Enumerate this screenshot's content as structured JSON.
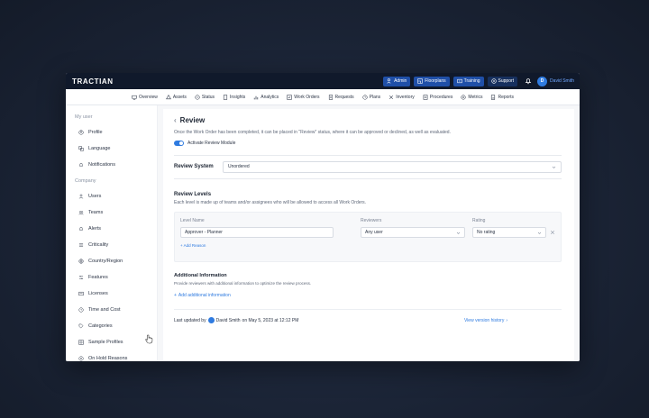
{
  "topbar": {
    "logo": "TRACTIAN",
    "buttons": [
      {
        "label": "Admin",
        "icon": "user-shield-icon"
      },
      {
        "label": "Floorplans",
        "icon": "floorplan-icon"
      },
      {
        "label": "Training",
        "icon": "training-icon"
      },
      {
        "label": "Support",
        "icon": "support-icon"
      }
    ],
    "user": {
      "initial": "D",
      "name": "David Smith"
    }
  },
  "nav": [
    {
      "label": "Overview",
      "icon": "monitor-icon"
    },
    {
      "label": "Assets",
      "icon": "assets-icon"
    },
    {
      "label": "Status",
      "icon": "status-icon"
    },
    {
      "label": "Insights",
      "icon": "insights-icon"
    },
    {
      "label": "Analytics",
      "icon": "analytics-icon"
    },
    {
      "label": "Work Orders",
      "icon": "work-orders-icon"
    },
    {
      "label": "Requests",
      "icon": "requests-icon"
    },
    {
      "label": "Plans",
      "icon": "plans-icon"
    },
    {
      "label": "Inventory",
      "icon": "inventory-icon"
    },
    {
      "label": "Procedures",
      "icon": "procedures-icon"
    },
    {
      "label": "Metrics",
      "icon": "metrics-icon"
    },
    {
      "label": "Reports",
      "icon": "reports-icon"
    }
  ],
  "sidebar": {
    "section_user": "My user",
    "user_items": [
      {
        "label": "Profile",
        "icon": "profile-icon"
      },
      {
        "label": "Language",
        "icon": "language-icon"
      },
      {
        "label": "Notifications",
        "icon": "bell-icon"
      }
    ],
    "section_company": "Company",
    "company_items": [
      {
        "label": "Users",
        "icon": "user-icon"
      },
      {
        "label": "Teams",
        "icon": "teams-icon"
      },
      {
        "label": "Alerts",
        "icon": "alert-bell-icon"
      },
      {
        "label": "Criticality",
        "icon": "list-icon"
      },
      {
        "label": "Country/Region",
        "icon": "globe-icon"
      },
      {
        "label": "Features",
        "icon": "features-icon"
      },
      {
        "label": "Licenses",
        "icon": "license-icon"
      },
      {
        "label": "Time and Cost",
        "icon": "clock-icon"
      },
      {
        "label": "Categories",
        "icon": "tag-icon"
      },
      {
        "label": "Sample Profiles",
        "icon": "grid-icon"
      },
      {
        "label": "On Hold Reasons",
        "icon": "pause-icon"
      }
    ]
  },
  "review": {
    "title": "Review",
    "description": "Once the Work Order has been completed, it can be placed in \"Review\" status, where it can be approved or declined, as well as evaluated.",
    "toggle_label": "Activate Review Module",
    "toggle_on": true,
    "system_label": "Review System",
    "system_value": "Unordered",
    "levels_title": "Review Levels",
    "levels_desc": "Each level is made up of teams and/or assignees who will be allowed to access all Work Orders.",
    "col_level": "Level Name",
    "col_reviewers": "Reviewers",
    "col_rating": "Rating",
    "level_name": "Approver - Planner",
    "reviewers_value": "Any user",
    "rating_value": "No rating",
    "add_reason": "+ Add Reason",
    "addinfo_title": "Additional Information",
    "addinfo_desc": "Provide reviewers with additional information to optimize the review process.",
    "addinfo_link": "Add additional information",
    "updated_prefix": "Last updated by",
    "updated_user": "David Smith",
    "updated_suffix": "on May 5, 2023 at 12:12 PM",
    "version_history": "View version history"
  },
  "colors": {
    "accent": "#2f7be0",
    "topbar": "#10192b",
    "topbar_button": "#1f4fa8"
  }
}
